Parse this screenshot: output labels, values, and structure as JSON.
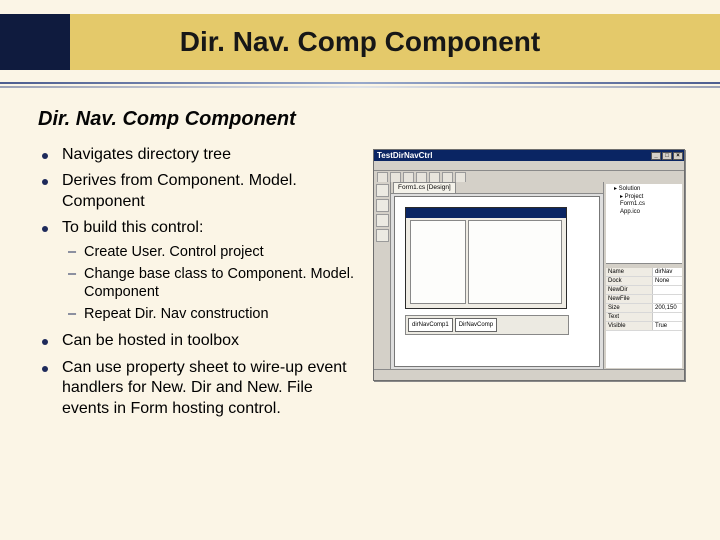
{
  "title": "Dir. Nav. Comp Component",
  "subheading": "Dir. Nav. Comp Component",
  "bullets": {
    "b1": "Navigates directory tree",
    "b2": "Derives from Component. Model. Component",
    "b3": "To build this control:",
    "b3_sub": {
      "s1": "Create User. Control project",
      "s2": "Change base class to Component. Model. Component",
      "s3": "Repeat Dir. Nav construction"
    },
    "b4": "Can be hosted in toolbox",
    "b5": "Can use property sheet to wire-up event handlers for New. Dir and New. File events in Form hosting control."
  },
  "ide": {
    "window_title": "TestDirNavCtrl",
    "tab": "Form1.cs [Design]",
    "tray": {
      "c1": "dirNavComp1",
      "c2": "DirNavComp"
    }
  }
}
